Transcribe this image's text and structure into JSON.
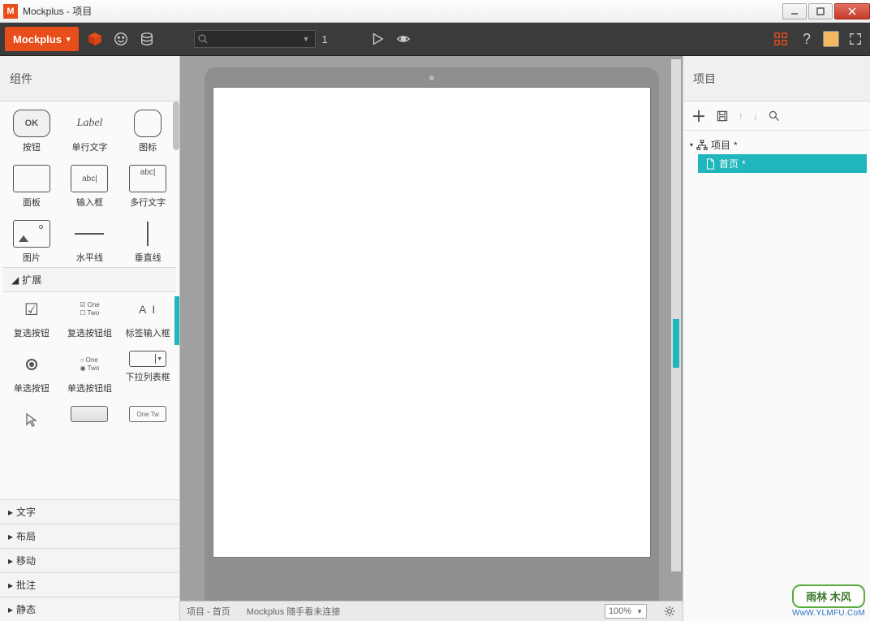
{
  "titlebar": {
    "app": "M",
    "title": "Mockplus - 项目"
  },
  "toolbar": {
    "brand": "Mockplus",
    "page_number": "1"
  },
  "left": {
    "title": "组件",
    "section_expand": "扩展",
    "basic": [
      {
        "label": "按钮",
        "glyph": "OK"
      },
      {
        "label": "单行文字",
        "glyph": "Label"
      },
      {
        "label": "图标",
        "glyph": ""
      },
      {
        "label": "面板",
        "glyph": ""
      },
      {
        "label": "输入框",
        "glyph": "abc|"
      },
      {
        "label": "多行文字",
        "glyph": "abc|"
      },
      {
        "label": "图片",
        "glyph": ""
      },
      {
        "label": "水平线",
        "glyph": ""
      },
      {
        "label": "垂直线",
        "glyph": ""
      }
    ],
    "ext": [
      {
        "label": "复选按钮",
        "glyph": "☑"
      },
      {
        "label": "复选按钮组",
        "top": "☑ One",
        "bot": "☐ Two"
      },
      {
        "label": "标签输入框",
        "glyph": "A I"
      },
      {
        "label": "单选按钮",
        "glyph": ""
      },
      {
        "label": "单选按钮组",
        "top": "○ One",
        "bot": "◉ Two"
      },
      {
        "label": "下拉列表框",
        "glyph": ""
      }
    ],
    "collapsed": [
      "文字",
      "布局",
      "移动",
      "批注",
      "静态"
    ]
  },
  "right": {
    "title": "项目",
    "root": "项目",
    "root_mod": "*",
    "page": "首页",
    "page_mod": "*"
  },
  "status": {
    "path": "项目 - 首页",
    "msg": "Mockplus 随手看未连接",
    "zoom": "100%"
  },
  "watermark": {
    "text": "雨林  木风",
    "url": "WwW.YLMFU.CoM"
  }
}
